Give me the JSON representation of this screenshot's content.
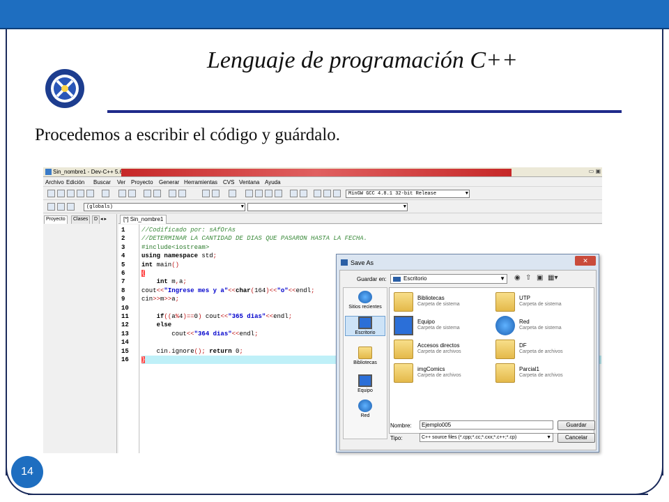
{
  "slide": {
    "title": "Lenguaje de programación C++",
    "subtitle": "Procedemos a escribir el código y guárdalo.",
    "page_number": "14"
  },
  "ide": {
    "window_title": "Sin_nombre1 - Dev-C++ 5.6.3",
    "menu": [
      "Archivo",
      "Edición",
      "Buscar",
      "Ver",
      "Proyecto",
      "Generar",
      "Herramientas",
      "CVS",
      "Ventana",
      "Ayuda"
    ],
    "compiler_select": "MinGW GCC 4.8.1 32-bit Release",
    "scope_select": "(globals)",
    "panel_tabs": [
      "Proyecto",
      "Clases",
      "D"
    ],
    "editor_tab": "[*] Sin_nombre1",
    "line_numbers": [
      "1",
      "2",
      "3",
      "4",
      "5",
      "6",
      "7",
      "8",
      "9",
      "10",
      "11",
      "12",
      "13",
      "14",
      "15",
      "16"
    ]
  },
  "save_dialog": {
    "title": "Save As",
    "close_label": "✕",
    "save_in_label": "Guardar en:",
    "save_in_value": "Escritorio",
    "places": [
      "Sitios recientes",
      "Escritorio",
      "Bibliotecas",
      "Equipo",
      "Red"
    ],
    "items": [
      {
        "name": "Bibliotecas",
        "desc": "Carpeta de sistema"
      },
      {
        "name": "UTP",
        "desc": "Carpeta de sistema"
      },
      {
        "name": "Equipo",
        "desc": "Carpeta de sistema"
      },
      {
        "name": "Red",
        "desc": "Carpeta de sistema"
      },
      {
        "name": "Accesos directos",
        "desc": "Carpeta de archivos"
      },
      {
        "name": "DF",
        "desc": "Carpeta de archivos"
      },
      {
        "name": "imgComics",
        "desc": "Carpeta de archivos"
      },
      {
        "name": "Parcial1",
        "desc": "Carpeta de archivos"
      }
    ],
    "name_label": "Nombre:",
    "name_value": "Ejemplo005",
    "type_label": "Tipo:",
    "type_value": "C++ source files (*.cpp;*.cc;*.cxx;*.c++;*.cp)",
    "save_button": "Guardar",
    "cancel_button": "Cancelar"
  }
}
